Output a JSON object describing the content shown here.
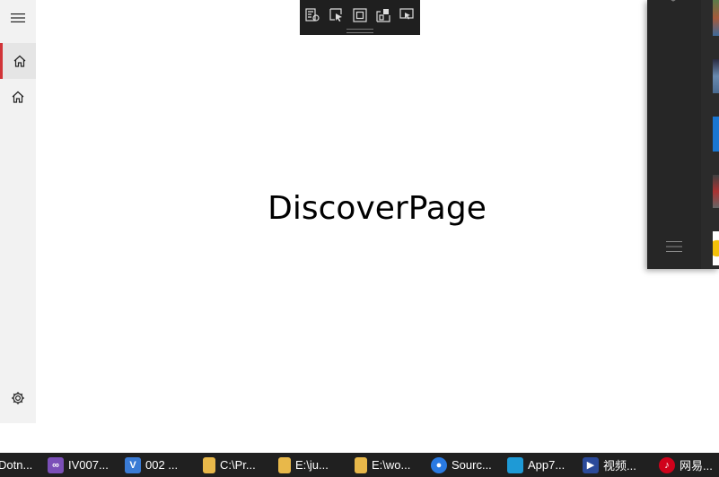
{
  "nav": {
    "items": [
      {
        "icon": "hamburger-icon"
      },
      {
        "icon": "home-icon",
        "selected": true
      },
      {
        "icon": "home-icon",
        "selected": false
      },
      {
        "icon": "gear-icon"
      }
    ],
    "accent_color": "#d13438"
  },
  "main": {
    "title": "DiscoverPage"
  },
  "toolbar": {
    "buttons": [
      {
        "icon": "live-visual-tree-icon"
      },
      {
        "icon": "select-element-icon"
      },
      {
        "icon": "display-layout-adorners-icon"
      },
      {
        "icon": "track-focus-icon"
      },
      {
        "icon": "hot-reload-icon"
      }
    ]
  },
  "flyout": {
    "menu_icon": "hamburger-icon"
  },
  "taskbar": {
    "items": [
      {
        "label": "Dotn...",
        "icon": "app-icon",
        "color": "#6b3fa0"
      },
      {
        "label": "IV007...",
        "icon": "visual-studio-icon",
        "color": "#7b4fb8"
      },
      {
        "label": "002 ...",
        "icon": "vs-code-icon",
        "color": "#3a7bd5"
      },
      {
        "label": "C:\\Pr...",
        "icon": "folder-icon",
        "color": "#e8b84a"
      },
      {
        "label": "E:\\ju...",
        "icon": "folder-icon",
        "color": "#e8b84a"
      },
      {
        "label": "E:\\wo...",
        "icon": "folder-icon",
        "color": "#e8b84a"
      },
      {
        "label": "Sourc...",
        "icon": "sourcetree-icon",
        "color": "#2a7ae2"
      },
      {
        "label": "App7...",
        "icon": "app-icon",
        "color": "#1e9ad6"
      },
      {
        "label": "视频...",
        "icon": "video-icon",
        "color": "#2b4a9a"
      },
      {
        "label": "网易...",
        "icon": "netease-music-icon",
        "color": "#d0021b"
      }
    ]
  }
}
